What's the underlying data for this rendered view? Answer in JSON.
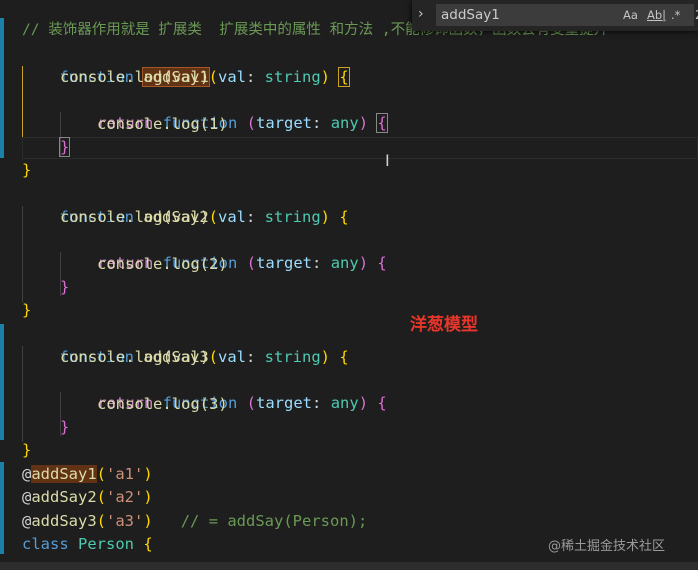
{
  "find_widget": {
    "query": "addSay1",
    "toggle_icon": "chevron-right",
    "option_case": "Aa",
    "option_word": "Ab|",
    "option_regex": ".*",
    "result_count": "2"
  },
  "overlay_label": "洋葱模型",
  "watermark": "@稀土掘金技术社区",
  "code": {
    "line1_comment": "// 装饰器作用就是 扩展类  扩展类中的属性 和方法 ,不能修饰函数，函数会有变量提升",
    "kw_function": "function",
    "fn1": "addSay1",
    "fn2": "addSay2",
    "fn3": "addSay3",
    "param": "val",
    "type_string": "string",
    "console_log_val": "console.log(val)",
    "kw_return": "return",
    "target": "target",
    "type_any": "any",
    "log1": "console.log(1)",
    "log2": "console.log(2)",
    "log3": "console.log(3)",
    "dec_a1": "'a1'",
    "dec_a2": "'a2'",
    "dec_a3": "'a3'",
    "trailing_comment": "// = addSay(Person);",
    "kw_class": "class",
    "class_name": "Person"
  }
}
